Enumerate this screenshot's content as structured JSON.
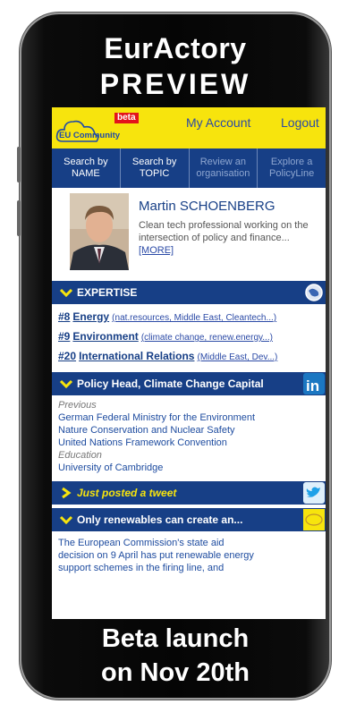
{
  "header": {
    "line1": "EurActory",
    "line2": "PREVIEW"
  },
  "footer": {
    "line1": "Beta launch",
    "line2": "on Nov 20th"
  },
  "topbar": {
    "logo_text": "EU Community",
    "beta": "beta",
    "my_account": "My Account",
    "logout": "Logout"
  },
  "nav": [
    {
      "line1": "Search by",
      "line2": "NAME"
    },
    {
      "line1": "Search by",
      "line2": "TOPIC"
    },
    {
      "line1": "Review an",
      "line2": "organisation"
    },
    {
      "line1": "Explore a",
      "line2": "PolicyLine"
    }
  ],
  "profile": {
    "name": "Martin SCHOENBERG",
    "bio": "Clean tech professional working on the intersection of policy and finance...",
    "more": "[MORE]"
  },
  "expertise": {
    "title": "EXPERTISE",
    "items": [
      {
        "rank": "#8",
        "name": "Energy",
        "tags": "(nat.resources, Middle East, Cleantech...)"
      },
      {
        "rank": "#9",
        "name": "Environment",
        "tags": "(climate change, renew.energy...)"
      },
      {
        "rank": "#20",
        "name": "International Relations",
        "tags": "(Middle East, Dev...)"
      }
    ]
  },
  "position": {
    "title": "Policy Head, Climate Change Capital",
    "previous_label": "Previous",
    "previous": [
      "German Federal Ministry for the Environment",
      "Nature Conservation and Nuclear Safety",
      "United Nations Framework Convention"
    ],
    "education_label": "Education",
    "education": "University of Cambridge"
  },
  "tweet": {
    "title": "Just posted a tweet"
  },
  "news": {
    "title": "Only renewables can create an...",
    "body": [
      "The European Commission's state aid",
      "decision on 9 April has put renewable energy",
      "support schemes in the firing line, and"
    ]
  },
  "colors": {
    "yellow": "#f7e40d",
    "navy": "#173f86",
    "link": "#2b4aa6"
  }
}
